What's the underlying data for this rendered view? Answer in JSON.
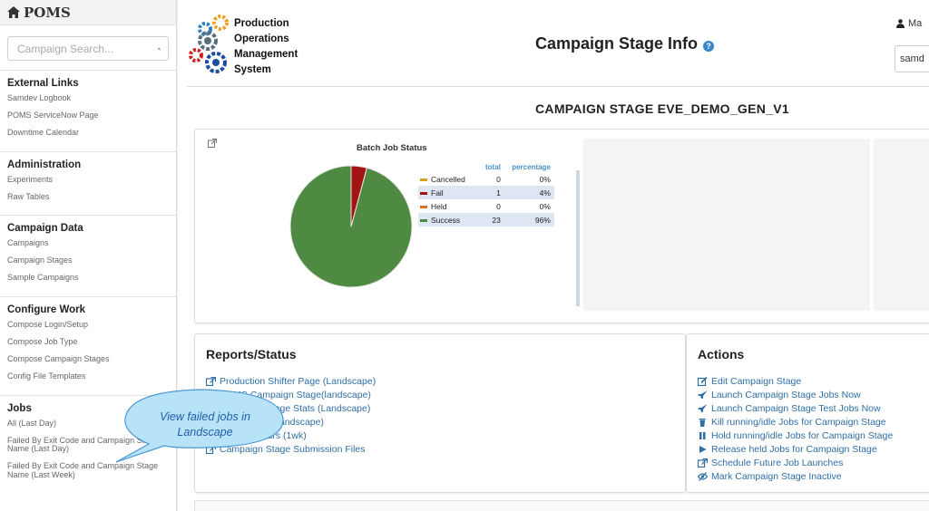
{
  "app": {
    "name": "POMS"
  },
  "sidebar": {
    "search_placeholder": "Campaign Search...",
    "sections": [
      {
        "title": "External Links",
        "items": [
          "Samdev Logbook",
          "POMS ServiceNow Page",
          "Downtime Calendar"
        ]
      },
      {
        "title": "Administration",
        "items": [
          "Experiments",
          "Raw Tables"
        ]
      },
      {
        "title": "Campaign Data",
        "items": [
          "Campaigns",
          "Campaign Stages",
          "Sample Campaigns"
        ]
      },
      {
        "title": "Configure Work",
        "items": [
          "Compose Login/Setup",
          "Compose Job Type",
          "Compose Campaign Stages",
          "Config File Templates"
        ]
      },
      {
        "title": "Jobs",
        "items": [
          "All (Last Day)",
          "Failed  By Exit Code and Campaign Stage Name (Last Day)",
          "Failed  By Exit Code and Campaign Stage Name (Last Week)"
        ]
      }
    ]
  },
  "header": {
    "logo_lines": [
      "Production",
      "Operations",
      "Management",
      "System"
    ],
    "page_title": "Campaign Stage Info",
    "help_glyph": "?",
    "user_name": "Ma",
    "role_value": "samd"
  },
  "stage_title": "CAMPAIGN STAGE EVE_DEMO_GEN_V1",
  "batch_status": {
    "title": "Batch Job Status",
    "col_total": "total",
    "col_percentage": "percentage",
    "rows": [
      {
        "name": "Cancelled",
        "total": "0",
        "pct": "0%",
        "color": "#d4a017"
      },
      {
        "name": "Fail",
        "total": "1",
        "pct": "4%",
        "color": "#a31515"
      },
      {
        "name": "Held",
        "total": "0",
        "pct": "0%",
        "color": "#e07020"
      },
      {
        "name": "Success",
        "total": "23",
        "pct": "96%",
        "color": "#4f8a43"
      }
    ]
  },
  "reports": {
    "title": "Reports/Status",
    "links": [
      "Production Shifter Page (Landscape)",
      "POMS Campaign Stage(landscape)",
      "Campaign Stage Stats (Landscape)",
      "Failed Jobs (Landscape)",
      "Job Time Bars (1wk)",
      "Campaign Stage Submission Files"
    ]
  },
  "actions": {
    "title": "Actions",
    "links": [
      {
        "label": "Edit Campaign Stage",
        "icon": "edit-icon"
      },
      {
        "label": "Launch Campaign Stage Jobs Now",
        "icon": "rocket-icon"
      },
      {
        "label": "Launch Campaign Stage Test Jobs Now",
        "icon": "rocket-icon"
      },
      {
        "label": "Kill running/idle Jobs for Campaign Stage",
        "icon": "trash-icon"
      },
      {
        "label": "Hold running/idle Jobs for Campaign Stage",
        "icon": "pause-icon"
      },
      {
        "label": "Release held Jobs for Campaign Stage",
        "icon": "play-icon"
      },
      {
        "label": "Schedule Future Job Launches",
        "icon": "external-link-icon"
      },
      {
        "label": "Mark Campaign Stage Inactive",
        "icon": "eye-slash-icon"
      }
    ]
  },
  "callout": {
    "line1": "View failed jobs in",
    "line2": "Landscape"
  }
}
